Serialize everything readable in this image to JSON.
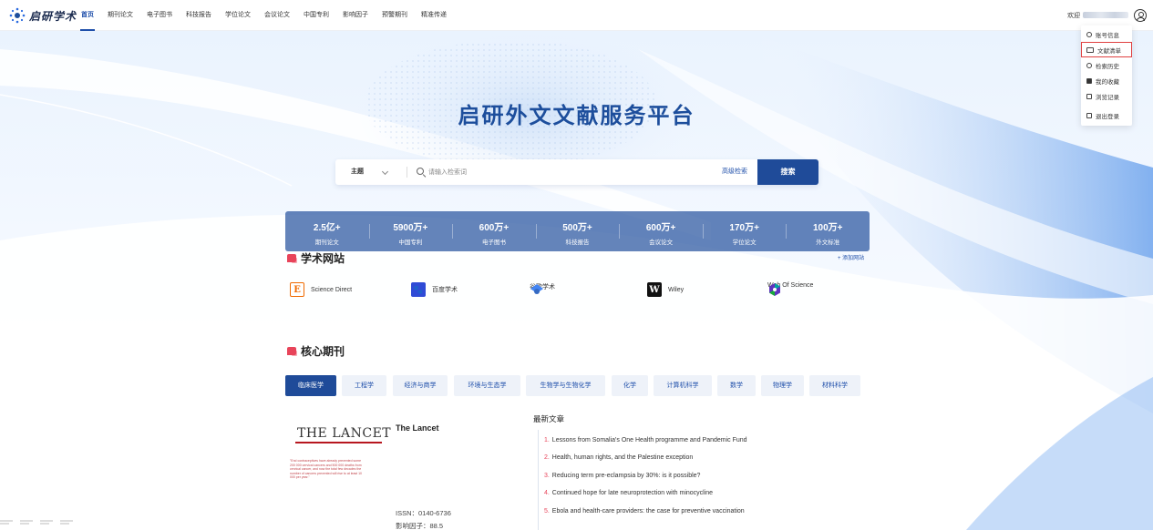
{
  "brand": {
    "name": "启研学术"
  },
  "nav": [
    {
      "label": "首页",
      "active": true
    },
    {
      "label": "期刊论文"
    },
    {
      "label": "电子图书"
    },
    {
      "label": "科技报告"
    },
    {
      "label": "学位论文"
    },
    {
      "label": "会议论文"
    },
    {
      "label": "中国专利"
    },
    {
      "label": "影响因子"
    },
    {
      "label": "预警期刊"
    },
    {
      "label": "精准传递"
    }
  ],
  "user": {
    "welcome": "欢迎"
  },
  "user_menu": {
    "items": [
      {
        "label": "账号信息",
        "icon": "user-circle-icon"
      },
      {
        "label": "文献清单",
        "icon": "book-open-icon",
        "highlighted": true
      },
      {
        "label": "检索历史",
        "icon": "history-icon"
      },
      {
        "label": "我的收藏",
        "icon": "bookmark-icon"
      },
      {
        "label": "浏览记录",
        "icon": "browse-icon"
      },
      {
        "label": "退出登录",
        "icon": "logout-icon"
      }
    ]
  },
  "hero": {
    "title": "启研外文文献服务平台"
  },
  "search": {
    "type": "主题",
    "placeholder": "请输入检索词",
    "advanced": "高级检索",
    "button": "搜索"
  },
  "stats": [
    {
      "value": "2.5亿+",
      "label": "期刊论文"
    },
    {
      "value": "5900万+",
      "label": "中国专利"
    },
    {
      "value": "600万+",
      "label": "电子图书"
    },
    {
      "value": "500万+",
      "label": "科技报告"
    },
    {
      "value": "600万+",
      "label": "会议论文"
    },
    {
      "value": "170万+",
      "label": "学位论文"
    },
    {
      "value": "100万+",
      "label": "外文标准"
    }
  ],
  "sites_section": {
    "title": "学术网站",
    "add": "+ 添加网站",
    "sites": [
      {
        "name": "Science Direct",
        "logo": "E"
      },
      {
        "name": "百度学术",
        "logo": "🐾"
      },
      {
        "name": "谷歌学术",
        "logo": ""
      },
      {
        "name": "Wiley",
        "logo": "W"
      },
      {
        "name": "Web Of Science",
        "logo": ""
      }
    ]
  },
  "journals_section": {
    "title": "核心期刊",
    "categories": [
      {
        "label": "临床医学",
        "active": true
      },
      {
        "label": "工程学"
      },
      {
        "label": "经济与商学"
      },
      {
        "label": "环境与生态学"
      },
      {
        "label": "生物学与生物化学"
      },
      {
        "label": "化学"
      },
      {
        "label": "计算机科学"
      },
      {
        "label": "数学"
      },
      {
        "label": "物理学"
      },
      {
        "label": "材料科学"
      }
    ],
    "journal": {
      "cover_title": "THE LANCET",
      "cover_text": "\"End contraceptives have already prevented some 200 000 cervical cancers and 500 000 deaths from cervical cancer, and now the total few decades the number of cancers prevented will rise to at least 10 000 per year.\"",
      "name": "The Lancet",
      "issn": "ISSN：0140-6736",
      "impact": "影响因子：88.5"
    },
    "latest": {
      "title": "最新文章",
      "articles": [
        {
          "num": "1.",
          "title": "Lessons from Somalia's One Health programme and Pandemic Fund"
        },
        {
          "num": "2.",
          "title": "Health, human rights, and the Palestine exception"
        },
        {
          "num": "3.",
          "title": "Reducing term pre-eclampsia by 30%: is it possible?"
        },
        {
          "num": "4.",
          "title": "Continued hope for late neuroprotection with minocycline"
        },
        {
          "num": "5.",
          "title": "Ebola and health-care providers: the case for preventive vaccination"
        }
      ]
    }
  },
  "colors": {
    "primary": "#1f4b99",
    "accent": "#e8445a",
    "title": "#1d4e9c"
  }
}
